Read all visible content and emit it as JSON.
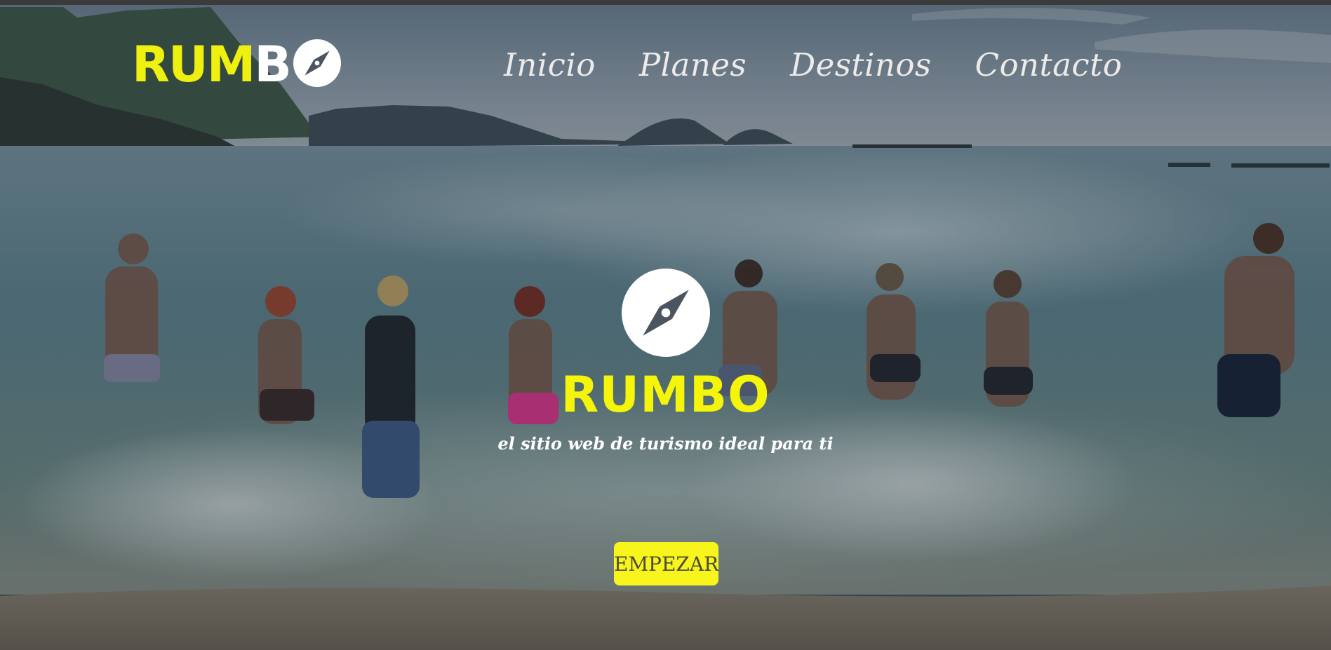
{
  "header": {
    "logo_part1": "RUM",
    "logo_part2": "B",
    "logo_icon": "compass-icon"
  },
  "nav": {
    "items": [
      "Inicio",
      "Planes",
      "Destinos",
      "Contacto"
    ]
  },
  "hero": {
    "icon": "compass-icon",
    "title": "RUMBO",
    "tagline": "el sitio web de turismo ideal para ti",
    "cta_label": "EMPEZAR"
  },
  "colors": {
    "accent_yellow": "#f5f50a",
    "button_yellow": "#f7f51c",
    "nav_text": "#ecebea"
  }
}
